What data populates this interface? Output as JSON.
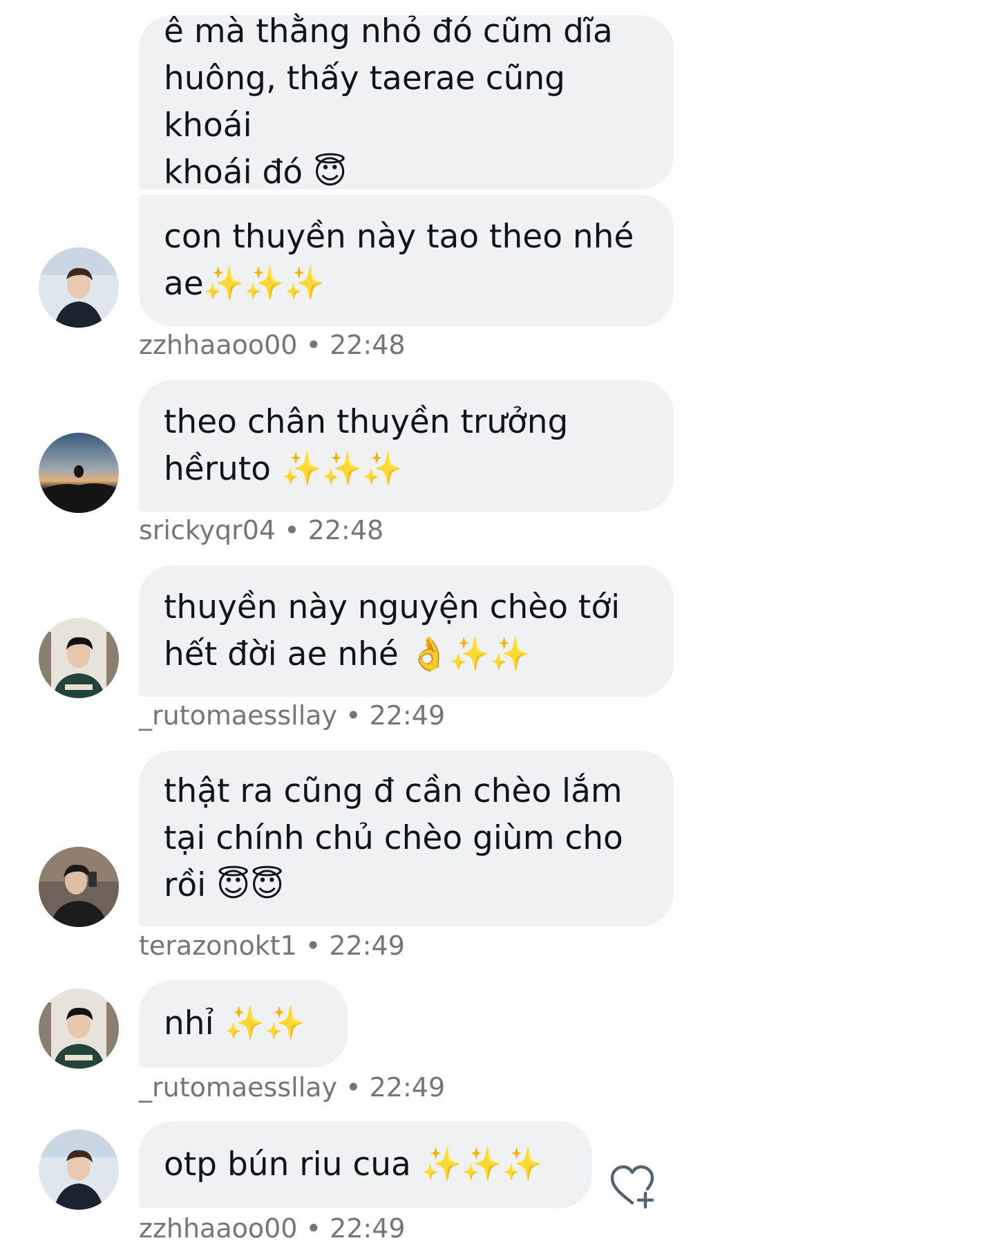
{
  "messages": [
    {
      "text": "ê mà thằng nhỏ đó cũm dĩa\nhuông, thấy taerae cũng khoái\nkhoái đó 😇"
    },
    {
      "text": "con thuyền này tao theo nhé\nae✨✨✨",
      "user": "zzhhaaoo00",
      "time": "22:48"
    },
    {
      "text": "theo chân thuyền trưởng\nhềruto ✨✨✨",
      "user": "srickyqr04",
      "time": "22:48"
    },
    {
      "text": "thuyền này nguyện chèo tới\nhết đời ae nhé 👌✨✨",
      "user": "_rutomaessllay",
      "time": "22:49"
    },
    {
      "text": "thật ra cũng đ cần chèo lắm\ntại chính chủ chèo giùm cho\nrồi 😇😇",
      "user": "terazonokt1",
      "time": "22:49"
    },
    {
      "text": "nhỉ ✨✨",
      "user": "_rutomaessllay",
      "time": "22:49"
    },
    {
      "text": "otp bún riu cua ✨✨✨",
      "user": "zzhhaaoo00",
      "time": "22:49"
    }
  ],
  "meta_separator": " • ",
  "icons": {
    "like": "heart-plus-icon"
  },
  "colors": {
    "bubble": "#eff1f3",
    "text": "#0f1419",
    "meta": "#71767b"
  }
}
